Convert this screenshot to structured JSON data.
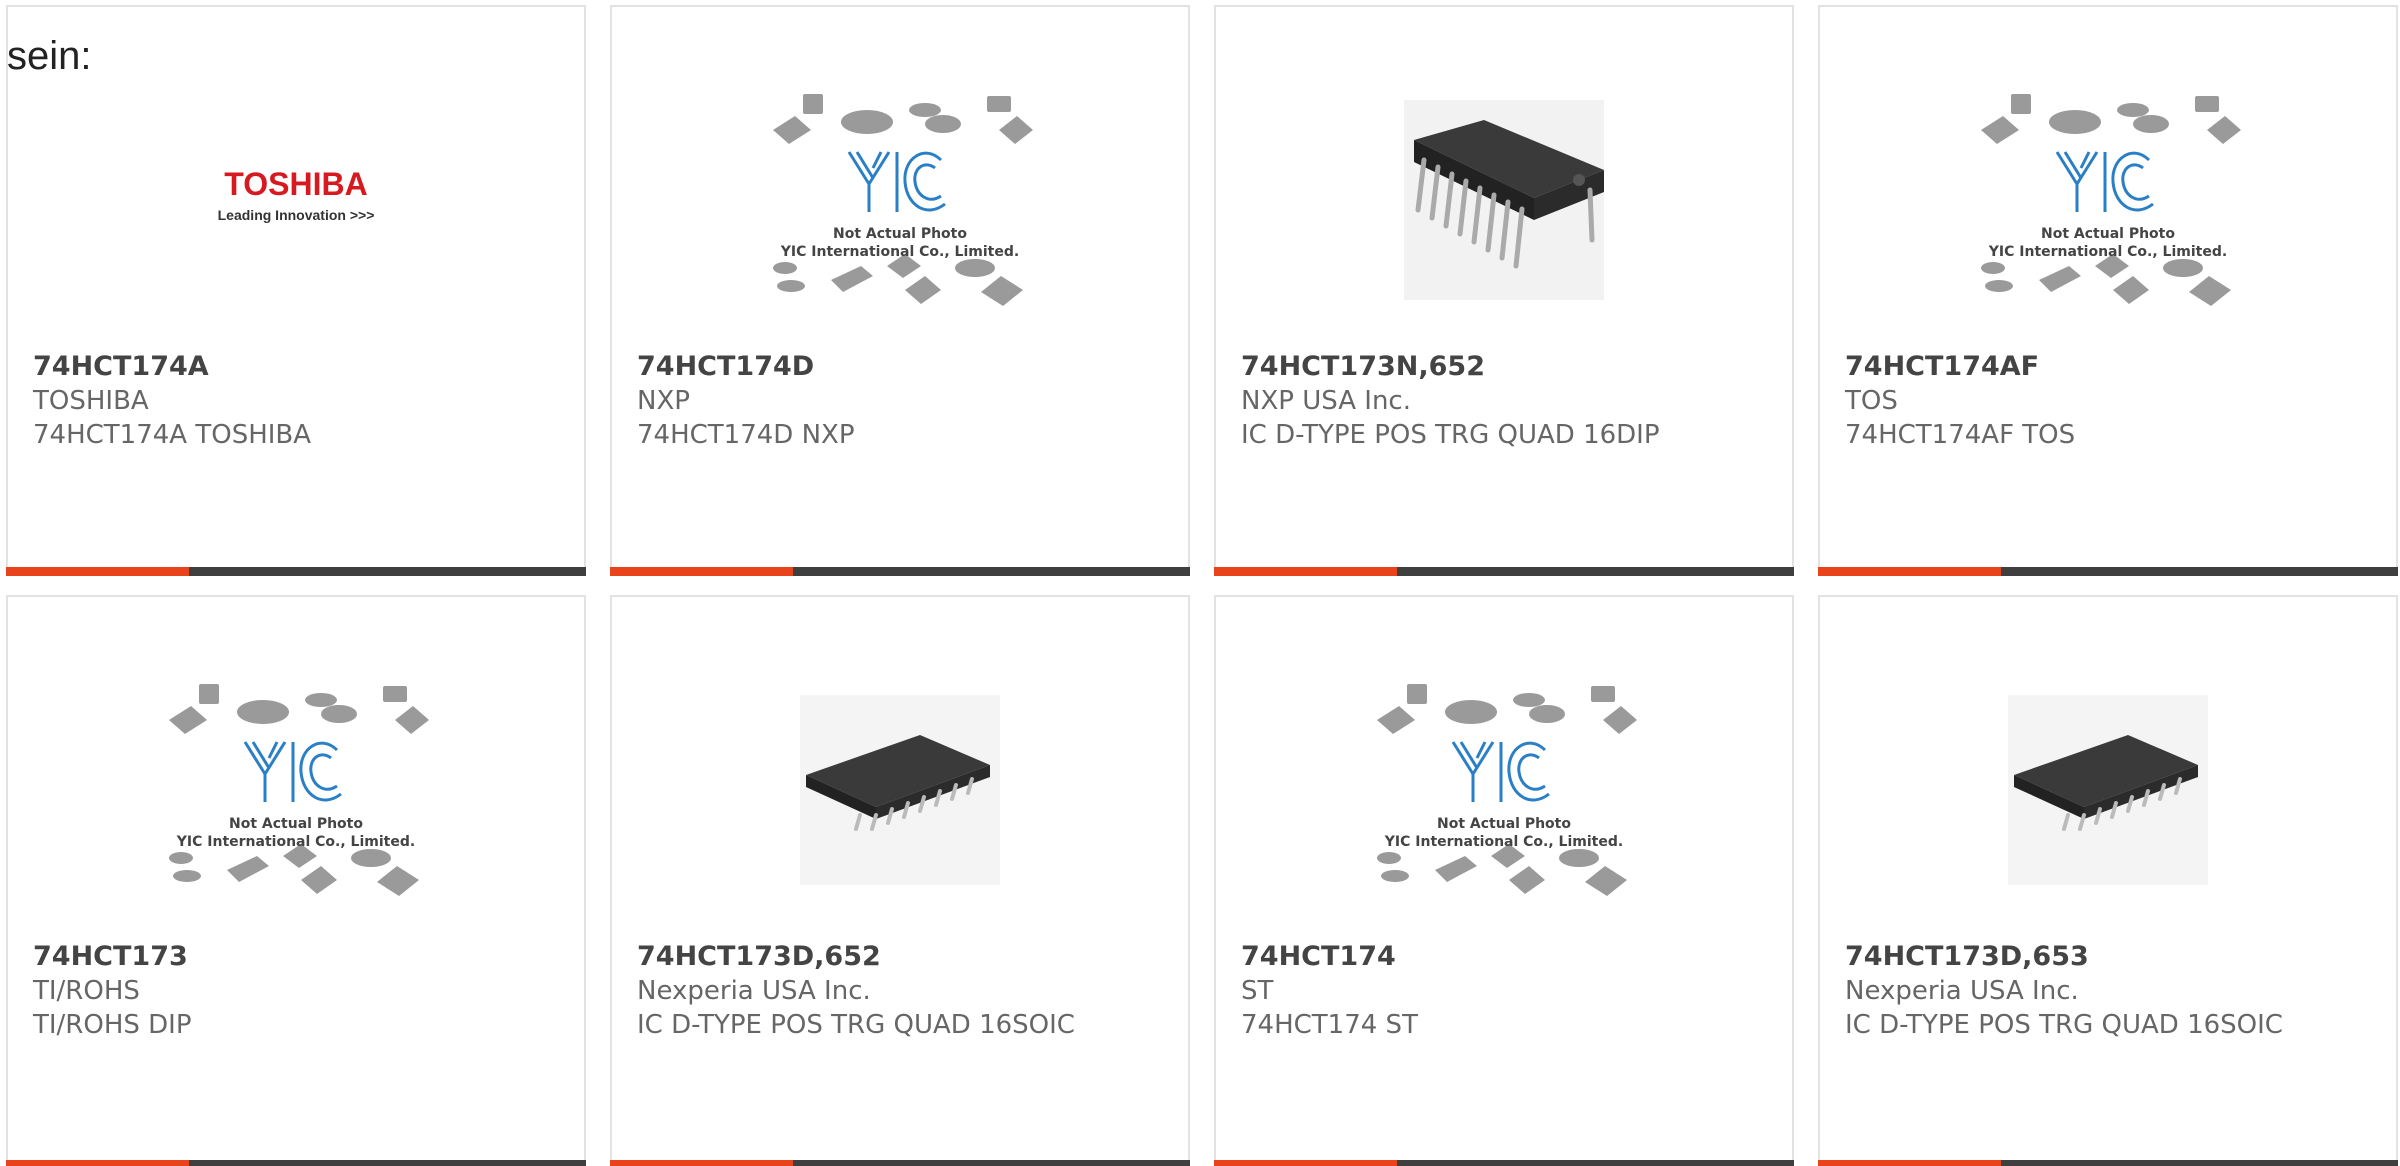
{
  "lead_text": "sein:",
  "colors": {
    "accent": "#e8431a",
    "bar_dark": "#3f3f3f",
    "card_border": "#e2e2e2",
    "yic_blue": "#2a7fc6",
    "toshiba_red": "#d71920"
  },
  "placeholder": {
    "brand": "YIC",
    "line1": "Not Actual Photo",
    "line2": "YIC International Co., Limited."
  },
  "toshiba_logo": {
    "name": "TOSHIBA",
    "tagline": "Leading Innovation >>>"
  },
  "products": [
    {
      "part": "74HCT174A",
      "manufacturer": "TOSHIBA",
      "description": "74HCT174A TOSHIBA",
      "image": "toshiba-logo"
    },
    {
      "part": "74HCT174D",
      "manufacturer": "NXP",
      "description": "74HCT174D NXP",
      "image": "yic-placeholder"
    },
    {
      "part": "74HCT173N,652",
      "manufacturer": "NXP USA Inc.",
      "description": "IC D-TYPE POS TRG QUAD 16DIP",
      "image": "dip-chip-photo"
    },
    {
      "part": "74HCT174AF",
      "manufacturer": "TOS",
      "description": "74HCT174AF TOS",
      "image": "yic-placeholder"
    },
    {
      "part": "74HCT173",
      "manufacturer": "TI/ROHS",
      "description": "TI/ROHS DIP",
      "image": "yic-placeholder"
    },
    {
      "part": "74HCT173D,652",
      "manufacturer": "Nexperia USA Inc.",
      "description": "IC D-TYPE POS TRG QUAD 16SOIC",
      "image": "soic-chip-photo"
    },
    {
      "part": "74HCT174",
      "manufacturer": "ST",
      "description": "74HCT174 ST",
      "image": "yic-placeholder"
    },
    {
      "part": "74HCT173D,653",
      "manufacturer": "Nexperia USA Inc.",
      "description": "IC D-TYPE POS TRG QUAD 16SOIC",
      "image": "soic-chip-photo"
    }
  ]
}
